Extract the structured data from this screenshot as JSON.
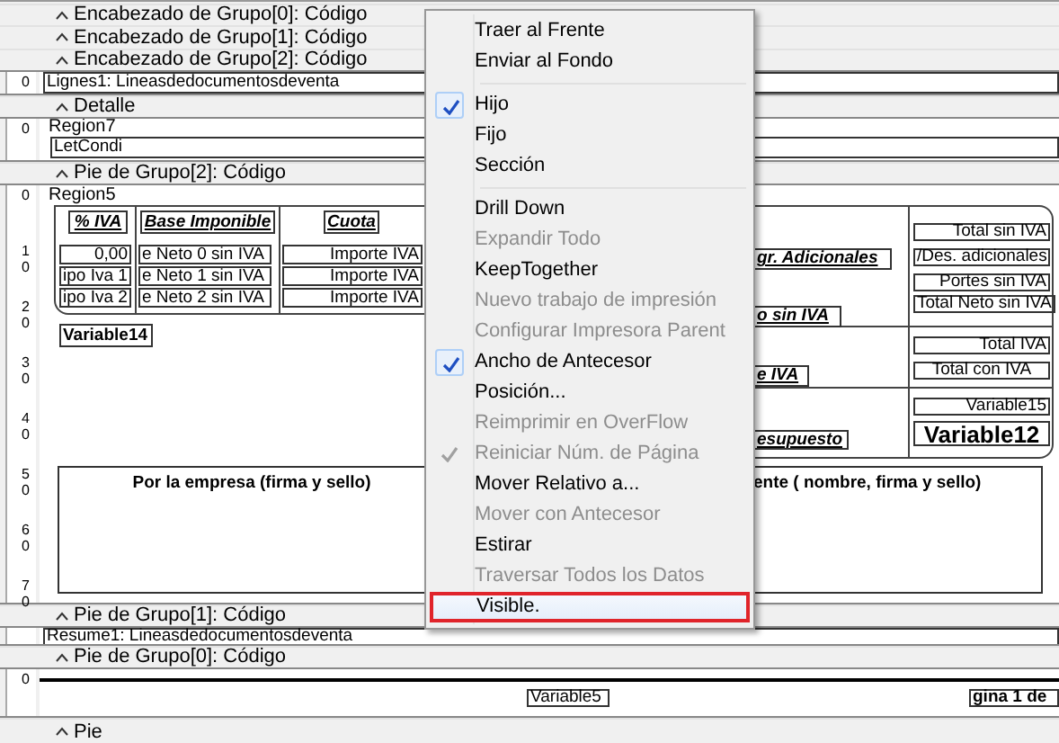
{
  "bands": [
    {
      "kind": "header",
      "label": "Encabezado de Grupo[0]: Código"
    },
    {
      "kind": "header",
      "label": "Encabezado de Grupo[1]: Código"
    },
    {
      "kind": "header",
      "label": "Encabezado de Grupo[2]: Código"
    },
    {
      "kind": "section",
      "ruler": [
        "0"
      ],
      "fields": [
        {
          "kind": "box",
          "text": "Lignes1: Lineasdedocumentosdeventa"
        }
      ]
    },
    {
      "kind": "header",
      "label": "Detalle"
    },
    {
      "kind": "section",
      "ruler": [
        "0"
      ],
      "fields": [
        {
          "kind": "label",
          "text": "Region7"
        },
        {
          "kind": "box",
          "text": "LetCondi"
        }
      ]
    },
    {
      "kind": "header",
      "label": "Pie de Grupo[2]: Código"
    },
    {
      "kind": "section",
      "ruler": [
        "0",
        "10",
        "20",
        "30",
        "40",
        "50",
        "60",
        "70"
      ],
      "fields": [
        {
          "kind": "label",
          "text": "Region5"
        },
        {
          "kind": "heading",
          "text": "% IVA"
        },
        {
          "kind": "heading",
          "text": "Base Imponible"
        },
        {
          "kind": "heading",
          "text": "Cuota"
        },
        {
          "kind": "box",
          "text": "0,00"
        },
        {
          "kind": "box",
          "text": "e Neto 0 sin IVA"
        },
        {
          "kind": "box",
          "text": "Importe IVA"
        },
        {
          "kind": "box",
          "text": "ipo Iva 1"
        },
        {
          "kind": "box",
          "text": "e Neto 1 sin IVA"
        },
        {
          "kind": "box",
          "text": "Importe IVA"
        },
        {
          "kind": "box",
          "text": "ipo Iva 2"
        },
        {
          "kind": "box",
          "text": "e Neto 2 sin IVA"
        },
        {
          "kind": "box",
          "text": "Importe IVA"
        },
        {
          "kind": "strong",
          "text": "Variable14"
        },
        {
          "kind": "heading",
          "text": "gr. Adicionales"
        },
        {
          "kind": "heading",
          "text": "o sin IVA"
        },
        {
          "kind": "heading",
          "text": "e IVA"
        },
        {
          "kind": "heading",
          "text": "esupuesto"
        },
        {
          "kind": "box",
          "text": "Total sin IVA"
        },
        {
          "kind": "box",
          "text": "/Des. adicionales"
        },
        {
          "kind": "box",
          "text": "Portes sin IVA"
        },
        {
          "kind": "box",
          "text": "Total Neto sin IVA"
        },
        {
          "kind": "box",
          "text": "Total IVA"
        },
        {
          "kind": "box",
          "text": "Total con IVA"
        },
        {
          "kind": "box",
          "text": "Variable15"
        },
        {
          "kind": "big",
          "text": "Variable12"
        },
        {
          "kind": "sign",
          "text": "Por la empresa (firma y sello)"
        },
        {
          "kind": "sign",
          "text": "ente ( nombre, firma y sello)"
        }
      ]
    },
    {
      "kind": "header",
      "label": "Pie de Grupo[1]: Código"
    },
    {
      "kind": "section",
      "fields": [
        {
          "kind": "box",
          "text": "Resume1: Lineasdedocumentosdeventa"
        }
      ]
    },
    {
      "kind": "header",
      "label": "Pie de Grupo[0]: Código"
    },
    {
      "kind": "section",
      "ruler": [
        "0"
      ],
      "fields": [
        {
          "kind": "box",
          "text": "Variable5"
        },
        {
          "kind": "strong",
          "text": "gina 1 de"
        }
      ]
    },
    {
      "kind": "header",
      "label": "Pie"
    }
  ],
  "context_menu": [
    {
      "kind": "item",
      "label": "Traer al Frente",
      "disabled": false,
      "checked": false,
      "selected": false
    },
    {
      "kind": "item",
      "label": "Enviar al Fondo",
      "disabled": false,
      "checked": false,
      "selected": false
    },
    {
      "kind": "separator"
    },
    {
      "kind": "item",
      "label": "Hijo",
      "disabled": false,
      "checked": true,
      "selected": false
    },
    {
      "kind": "item",
      "label": "Fijo",
      "disabled": false,
      "checked": false,
      "selected": false
    },
    {
      "kind": "item",
      "label": "Sección",
      "disabled": false,
      "checked": false,
      "selected": false
    },
    {
      "kind": "separator"
    },
    {
      "kind": "item",
      "label": "Drill Down",
      "disabled": false,
      "checked": false,
      "selected": false
    },
    {
      "kind": "item",
      "label": "Expandir Todo",
      "disabled": true,
      "checked": false,
      "selected": false
    },
    {
      "kind": "item",
      "label": "KeepTogether",
      "disabled": false,
      "checked": false,
      "selected": false
    },
    {
      "kind": "item",
      "label": "Nuevo trabajo de impresión",
      "disabled": true,
      "checked": false,
      "selected": false
    },
    {
      "kind": "item",
      "label": "Configurar Impresora Parent",
      "disabled": true,
      "checked": false,
      "selected": false
    },
    {
      "kind": "item",
      "label": "Ancho de Antecesor",
      "disabled": false,
      "checked": true,
      "selected": false
    },
    {
      "kind": "item",
      "label": "Posición...",
      "disabled": false,
      "checked": false,
      "selected": false
    },
    {
      "kind": "item",
      "label": "Reimprimir en OverFlow",
      "disabled": true,
      "checked": false,
      "selected": false
    },
    {
      "kind": "item",
      "label": "Reiniciar Núm. de Página",
      "disabled": true,
      "checked": true,
      "selected": false
    },
    {
      "kind": "item",
      "label": "Mover Relativo a...",
      "disabled": false,
      "checked": false,
      "selected": false
    },
    {
      "kind": "item",
      "label": "Mover con Antecesor",
      "disabled": true,
      "checked": false,
      "selected": false
    },
    {
      "kind": "item",
      "label": "Estirar",
      "disabled": false,
      "checked": false,
      "selected": false
    },
    {
      "kind": "item",
      "label": "Traversar Todos los Datos",
      "disabled": true,
      "checked": false,
      "selected": false
    },
    {
      "kind": "item",
      "label": "Visible.",
      "disabled": false,
      "checked": false,
      "selected": true
    }
  ]
}
